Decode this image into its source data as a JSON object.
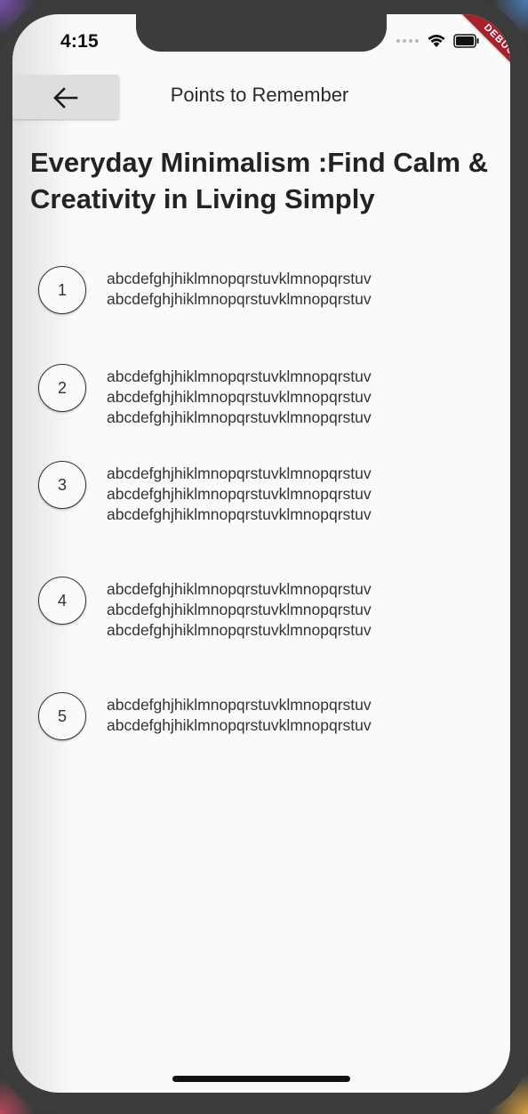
{
  "status_bar": {
    "time": "4:15",
    "debug_banner": "DEBUG"
  },
  "appbar": {
    "back_icon": "arrow-left-icon",
    "title": "Points to Remember"
  },
  "page": {
    "title": "Everyday Minimalism :Find Calm & Creativity in Living Simply"
  },
  "points": [
    {
      "number": "1",
      "lines": [
        "abcdefghjhiklmnopqrstuvklmnopqrstuv",
        "abcdefghjhiklmnopqrstuvklmnopqrstuv"
      ]
    },
    {
      "number": "2",
      "lines": [
        "abcdefghjhiklmnopqrstuvklmnopqrstuv",
        "abcdefghjhiklmnopqrstuvklmnopqrstuv",
        "abcdefghjhiklmnopqrstuvklmnopqrstuv"
      ]
    },
    {
      "number": "3",
      "lines": [
        "abcdefghjhiklmnopqrstuvklmnopqrstuv",
        "abcdefghjhiklmnopqrstuvklmnopqrstuv",
        "abcdefghjhiklmnopqrstuvklmnopqrstuv"
      ]
    },
    {
      "number": "4",
      "lines": [
        "abcdefghjhiklmnopqrstuvklmnopqrstuv",
        "abcdefghjhiklmnopqrstuvklmnopqrstuv",
        "abcdefghjhiklmnopqrstuvklmnopqrstuv"
      ]
    },
    {
      "number": "5",
      "lines": [
        "abcdefghjhiklmnopqrstuvklmnopqrstuv",
        "abcdefghjhiklmnopqrstuvklmnopqrstuv"
      ]
    }
  ],
  "colors": {
    "background": "#fafafa",
    "debug_banner": "#a8202a",
    "text": "#333333"
  }
}
